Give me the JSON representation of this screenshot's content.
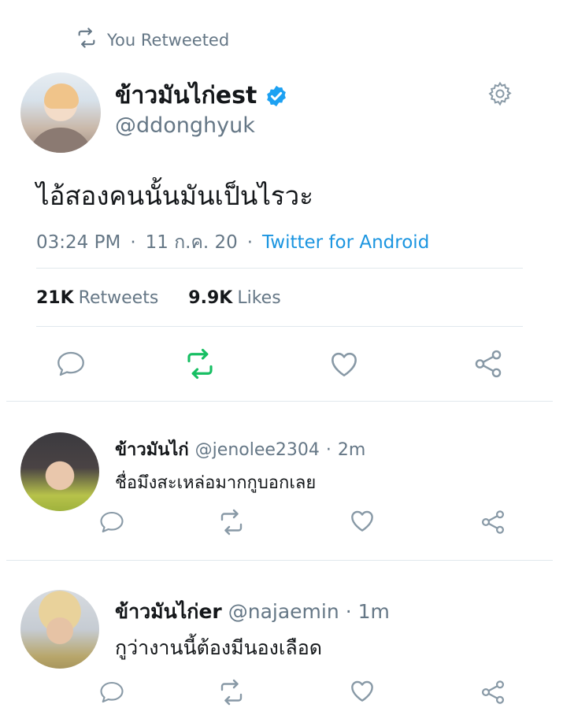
{
  "retweet_banner": {
    "label": "You Retweeted"
  },
  "tweet": {
    "display_name": "ข้าวมันไก่est",
    "handle": "@ddonghyuk",
    "text": "ไอ้สองคนนั้นมันเป็นไรวะ",
    "time": "03:24 PM",
    "date": "11 ก.ค. 20",
    "separator": "·",
    "source": "Twitter for Android",
    "retweets_count": "21K",
    "retweets_label": "Retweets",
    "likes_count": "9.9K",
    "likes_label": "Likes"
  },
  "replies": [
    {
      "display_name": "ข้าวมันไก่",
      "handle": "@jenolee2304",
      "separator": "·",
      "time": "2m",
      "text": "ชื่อมึงสะเหล่อมากกูบอกเลย"
    },
    {
      "display_name": "ข้าวมันไก่er",
      "handle": "@najaemin",
      "separator": "·",
      "time": "1m",
      "text": "กูว่างานนี้ต้องมีนองเลือด"
    }
  ],
  "colors": {
    "text_primary": "#14171a",
    "text_secondary": "#657786",
    "accent_blue": "#1b95e0",
    "verified_blue": "#1da1f2",
    "retweet_green": "#17bf63",
    "divider": "#e1e8ed"
  },
  "icons": {
    "retweet_banner": "retweet-icon",
    "verified": "verified-badge-icon",
    "settings": "gear-icon",
    "reply": "reply-icon",
    "retweet": "retweet-icon",
    "like": "heart-icon",
    "share": "share-icon"
  }
}
